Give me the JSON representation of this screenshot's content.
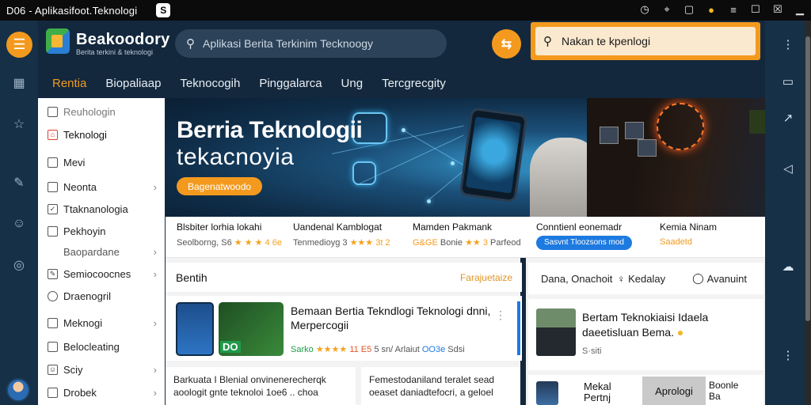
{
  "titlebar": {
    "title": "D06 - Aplikasifoot.Teknologi",
    "app_chip": "S"
  },
  "header": {
    "logo_text": "Beakoodory",
    "logo_sub": "Berita terkini & teknologi",
    "search_placeholder": "Aplikasi Berita Terkinim Tecknoogy",
    "search2_placeholder": "Nakan te kpenlogi"
  },
  "nav": {
    "tabs": [
      "Rentia",
      "Biopaliaap",
      "Teknocogih",
      "Pinggalarca",
      "Ung",
      "Tercgrecgity"
    ],
    "active_index": 0
  },
  "sidebar": {
    "items": [
      {
        "label": "Reuhologin",
        "icon": "document-icon"
      },
      {
        "label": "Teknologi",
        "icon": "home-icon",
        "active": true
      },
      {
        "label": "Mevi",
        "icon": "square-icon"
      },
      {
        "label": "Neonta",
        "icon": "tag-icon",
        "chevron": true
      },
      {
        "label": "Ttaknanologia",
        "icon": "shield-icon"
      },
      {
        "label": "Pekhoyin",
        "icon": "bookmark-icon"
      },
      {
        "label": "Baopardane",
        "sub": true,
        "chevron": true
      },
      {
        "label": "Semiocoocnes",
        "icon": "edit-icon",
        "chevron": true
      },
      {
        "label": "Draenogril",
        "icon": "circle-icon"
      },
      {
        "label": "Meknogi",
        "icon": "grid-icon",
        "chevron": true
      },
      {
        "label": "Belocleating",
        "icon": "folder-icon"
      },
      {
        "label": "Sciy",
        "icon": "smile-icon",
        "chevron": true
      },
      {
        "label": "Drobek",
        "icon": "book-icon",
        "chevron": true
      }
    ]
  },
  "hero": {
    "title": "Berria Teknologii",
    "subtitle": "tekacnoyia",
    "cta": "Bagenatwoodo"
  },
  "strip": [
    {
      "title": "Blsbiter lorhia lokahi",
      "meta": "Seolborng, S6",
      "stars": "★ ★ ★ 4 6e"
    },
    {
      "title": "Uandenal Kamblogat",
      "meta": "Tenmedioyg 3",
      "stars": "★★★ 3t 2"
    },
    {
      "title": "Mamden Pakmank",
      "meta_org": "G&GE",
      "meta": "Bonie",
      "stars": "★★ 3",
      "meta2": "Parfeod"
    },
    {
      "title": "Conntienl eonemadr",
      "pill": "Sasvnt Tloozsons mod"
    },
    {
      "title": "Kemia Ninam",
      "meta_org": "Saadetd"
    }
  ],
  "feed": {
    "head_title": "Bentih",
    "head_more": "Farajuetaize",
    "card": {
      "title": "Bemaan Bertia Tekndlogi Teknologi dnni, Merpercogii",
      "badge": "DO",
      "meta_label": "Sarko",
      "stars": "★★★★",
      "count": "11 E5",
      "meta_time": "5 sn/ Arlaiut",
      "meta_blue": "OO3e",
      "meta_end": "Sdsi"
    },
    "card2a": "Barkuata  I  Blenial onvinenerecherqk aoologit gnte teknoloi 1oe6 .. choa",
    "card2b": "Femestodaniland teralet sead oeaset daniadtefocri, a geloel"
  },
  "rightcol": {
    "tabs": [
      "Dana, Onachoit",
      "Kedalay",
      "Avanuint"
    ],
    "card_title": "Bertam Teknokiaisi Idaela daeetisluan Bema.",
    "card_meta": "S·siti",
    "card2_title1": "Mekal",
    "card2_title1b": "Pertnj",
    "card2_tag": "Aprologi",
    "card2_title2": "Boonle",
    "card2_title2b": "Ba"
  },
  "colors": {
    "accent": "#f39a1e",
    "bg": "#13283d",
    "pill_blue": "#1d7ae0"
  }
}
